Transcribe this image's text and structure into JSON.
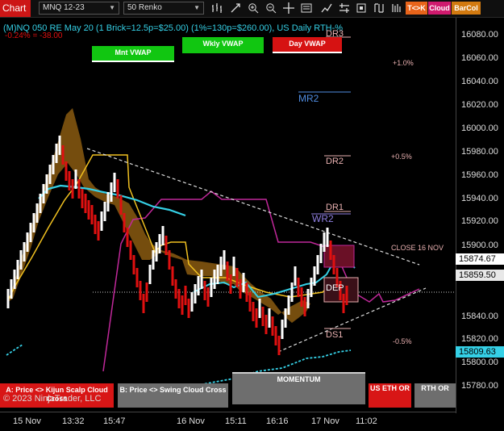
{
  "toolbar": {
    "title": "Chart",
    "instrument": "MNQ 12-23",
    "bar_type": "50 Renko",
    "tags": [
      "T<>K",
      "Cloud",
      "BarCol"
    ]
  },
  "info": {
    "line1": "(M)NQ 050 RE May 20 (1 Brick=12.5p=$25.00) (1%=130p=$260.00), US Daily RTH-%",
    "line2": "-0.24% = -38.00"
  },
  "vwap_buttons": [
    "Mnt VWAP",
    "Wkly VWAP",
    "Day VWAP"
  ],
  "levels": {
    "dr3": "DR3",
    "mr2": "MR2",
    "dr2": "DR2",
    "dr1": "DR1",
    "wr2": "WR2",
    "dep": "DEP",
    "ds1": "DS1",
    "close": "CLOSE 16 NOV"
  },
  "percents": [
    "+1.0%",
    "+0.5%",
    "-0.5%"
  ],
  "price_axis": {
    "ticks": [
      "16080.00",
      "16060.00",
      "16040.00",
      "16020.00",
      "16000.00",
      "15980.00",
      "15960.00",
      "15940.00",
      "15920.00",
      "15900.00",
      "15860.00",
      "15840.00",
      "15820.00",
      "15800.00",
      "15780.00"
    ],
    "last_price": "15859.50",
    "flag_upper": "15874.67",
    "flag_lower": "15809.63"
  },
  "time_axis": [
    "15 Nov",
    "13:32",
    "15:47",
    "16 Nov",
    "15:11",
    "16:16",
    "17 Nov",
    "11:02"
  ],
  "bottom": {
    "kijun": "A: Price <> Kijun Scalp Cloud Cross",
    "swing": "B: Price <> Swing Cloud Cross",
    "momentum": "MOMENTUM",
    "us_eth": "US ETH OR",
    "rth": "RTH OR",
    "copyright": "© 2023 NinjaTrader, LLC"
  },
  "colors": {
    "up": "#ffffff",
    "down": "#e01010",
    "kijun_fill": "#8a5a10",
    "vwap_month": "#11c611",
    "vwap_week": "#11c611",
    "vwap_day": "#e01010",
    "magenta": "#c0289a",
    "cyan": "#35d0e6",
    "gold": "#f0c020"
  }
}
